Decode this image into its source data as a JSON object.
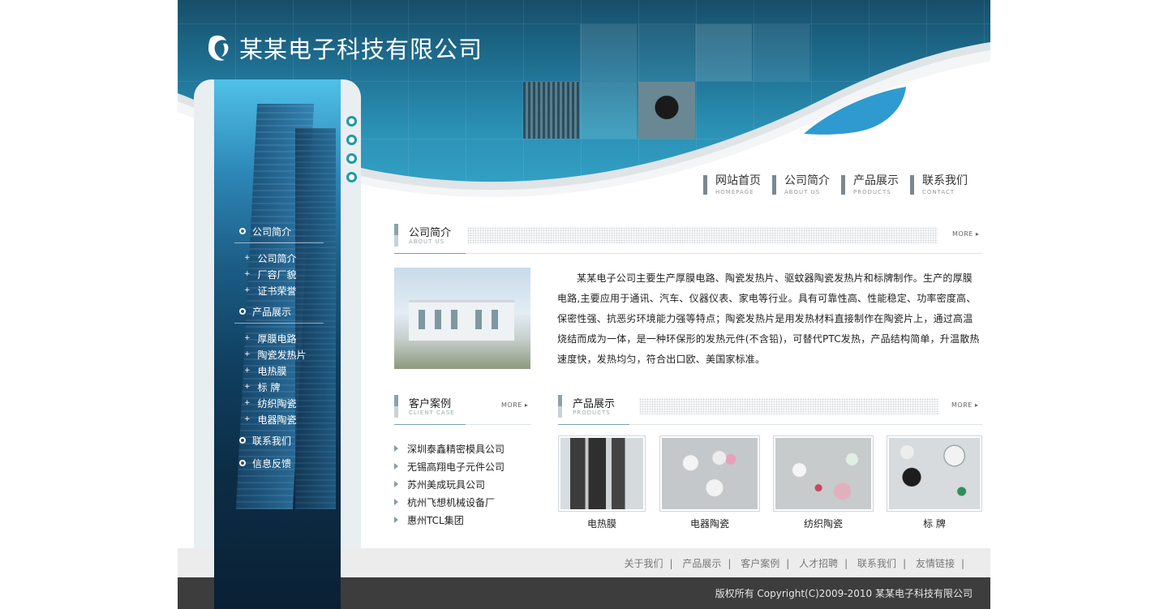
{
  "site": {
    "title": "某某电子科技有限公司"
  },
  "nav": [
    {
      "cn": "网站首页",
      "en": "HOMEPAGE"
    },
    {
      "cn": "公司简介",
      "en": "ABOUT US"
    },
    {
      "cn": "产品展示",
      "en": "PRODUCTS"
    },
    {
      "cn": "联系我们",
      "en": "CONTACT"
    }
  ],
  "sidebar": {
    "groups": [
      {
        "label": "公司简介",
        "items": [
          "公司简介",
          "厂容厂貌",
          "证书荣誉"
        ]
      },
      {
        "label": "产品展示",
        "items": [
          "厚膜电路",
          "陶瓷发热片",
          "电热膜",
          "标 牌",
          "纺织陶瓷",
          "电器陶瓷"
        ]
      },
      {
        "label": "联系我们",
        "items": []
      },
      {
        "label": "信息反馈",
        "items": []
      }
    ]
  },
  "about": {
    "title": "公司简介",
    "en": "ABOUT US",
    "more": "MORE",
    "text": "某某电子公司主要生产厚膜电路、陶瓷发热片、驱蚊器陶瓷发热片和标牌制作。生产的厚膜电路,主要应用于通讯、汽车、仪器仪表、家电等行业。具有可靠性高、性能稳定、功率密度高、保密性强、抗恶劣环境能力强等特点；陶瓷发热片是用发热材料直接制作在陶瓷片上，通过高温烧结而成为一体，是一种环保形的发热元件(不含铅)，可替代PTC发热，产品结构简单，升温散热速度快，发热均匀，符合出口欧、美国家标准。"
  },
  "clients": {
    "title": "客户案例",
    "en": "CLIENT CASE",
    "more": "MORE",
    "items": [
      "深圳泰鑫精密模具公司",
      "无锡高翔电子元件公司",
      "苏州美成玩具公司",
      "杭州飞想机械设备厂",
      "惠州TCL集团"
    ]
  },
  "products": {
    "title": "产品展示",
    "en": "PRODUCTS",
    "more": "MORE",
    "items": [
      "电热膜",
      "电器陶瓷",
      "纺织陶瓷",
      "标 牌"
    ]
  },
  "footer": {
    "links": [
      "关于我们",
      "产品展示",
      "客户案例",
      "人才招聘",
      "联系我们",
      "友情链接"
    ],
    "copyright": "版权所有 Copyright(C)2009-2010 某某电子科技有限公司"
  }
}
